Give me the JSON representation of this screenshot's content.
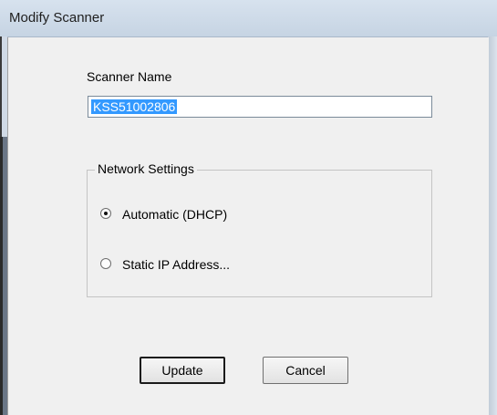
{
  "window": {
    "title": "Modify Scanner"
  },
  "scanner_name": {
    "label": "Scanner Name",
    "value": "KSS51002806"
  },
  "network_settings": {
    "legend": "Network Settings",
    "options": [
      {
        "label": "Automatic (DHCP)",
        "selected": true
      },
      {
        "label": "Static IP Address...",
        "selected": false
      }
    ]
  },
  "buttons": {
    "update_label": "Update",
    "cancel_label": "Cancel"
  }
}
